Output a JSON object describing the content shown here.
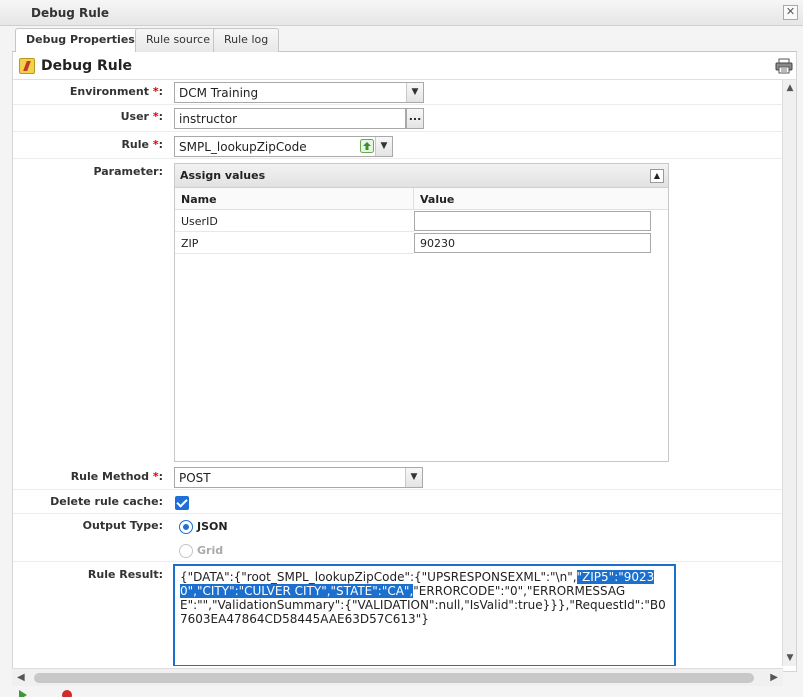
{
  "window": {
    "title": "Debug Rule",
    "close_glyph": "✕"
  },
  "tabs": [
    {
      "label": "Debug Properties",
      "active": true
    },
    {
      "label": "Rule source",
      "active": false
    },
    {
      "label": "Rule log",
      "active": false
    }
  ],
  "panel": {
    "title": "Debug Rule",
    "icon": "debug-rule-icon",
    "print_icon": "printer-icon"
  },
  "form": {
    "environment": {
      "label": "Environment",
      "required": "*",
      "suffix": ":",
      "value": "DCM Training"
    },
    "user": {
      "label": "User",
      "required": "*",
      "suffix": ":",
      "value": "instructor",
      "browse_label": "..."
    },
    "rule": {
      "label": "Rule",
      "required": "*",
      "suffix": ":",
      "value": "SMPL_lookupZipCode"
    },
    "parameter": {
      "label": "Parameter:",
      "grid_title": "Assign values",
      "columns": [
        "Name",
        "Value"
      ],
      "rows": [
        {
          "name": "UserID",
          "value": ""
        },
        {
          "name": "ZIP",
          "value": "90230"
        }
      ]
    },
    "rule_method": {
      "label": "Rule Method",
      "required": "*",
      "suffix": ":",
      "value": "POST"
    },
    "delete_cache": {
      "label": "Delete rule cache:",
      "checked": true
    },
    "output_type": {
      "label": "Output Type:",
      "options": [
        {
          "label": "JSON",
          "selected": true,
          "enabled": true
        },
        {
          "label": "Grid",
          "selected": false,
          "enabled": false
        }
      ]
    },
    "rule_result": {
      "label": "Rule Result:",
      "text_before": "{\"DATA\":{\"root_SMPL_lookupZipCode\":{\"UPSRESPONSEXML\":\"\\n\",",
      "text_selected": "\"ZIP5\":\"90230\",\"CITY\":\"CULVER CITY\",\"STATE\":\"CA\",",
      "text_after": "\"ERRORCODE\":\"0\",\"ERRORMESSAGE\":\"\",\"ValidationSummary\":{\"VALIDATION\":null,\"IsValid\":true}}},\"RequestId\":\"B07603EA47864CD58445AAE63D57C613\"}"
    }
  },
  "colors": {
    "accent": "#1a6fcf",
    "required": "#dd0000"
  }
}
